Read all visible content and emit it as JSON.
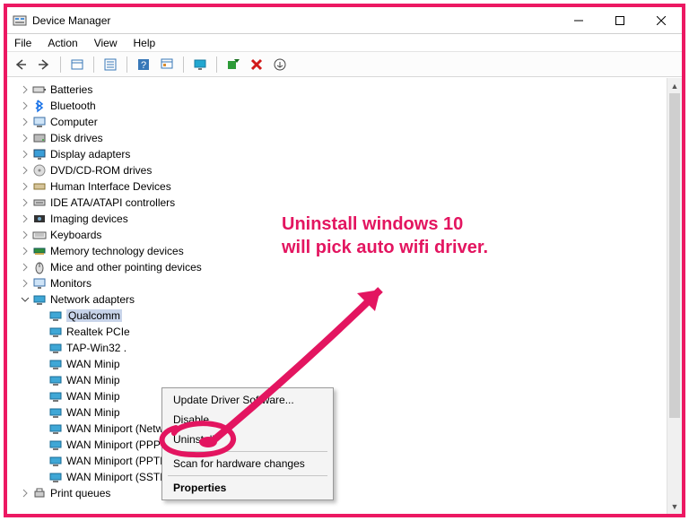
{
  "window": {
    "title": "Device Manager",
    "controls": {
      "min": "—",
      "max": "☐",
      "close": "✕"
    }
  },
  "menus": [
    "File",
    "Action",
    "View",
    "Help"
  ],
  "toolbar_icons": [
    "back",
    "forward",
    "show-hidden",
    "properties",
    "help",
    "update",
    "monitor",
    "scan",
    "delete",
    "more"
  ],
  "annotation": {
    "line1": "Uninstall windows 10",
    "line2": "will pick auto wifi driver."
  },
  "context_menu": {
    "items": [
      {
        "label": "Update Driver Software...",
        "bold": false
      },
      {
        "label": "Disable",
        "bold": false
      },
      {
        "label": "Uninstall",
        "bold": false
      },
      {
        "label": "Scan for hardware changes",
        "bold": false
      },
      {
        "label": "Properties",
        "bold": true
      }
    ]
  },
  "tree": {
    "categories": [
      {
        "label": "Batteries",
        "icon": "battery"
      },
      {
        "label": "Bluetooth",
        "icon": "bluetooth"
      },
      {
        "label": "Computer",
        "icon": "computer"
      },
      {
        "label": "Disk drives",
        "icon": "disk"
      },
      {
        "label": "Display adapters",
        "icon": "display"
      },
      {
        "label": "DVD/CD-ROM drives",
        "icon": "dvd"
      },
      {
        "label": "Human Interface Devices",
        "icon": "hid"
      },
      {
        "label": "IDE ATA/ATAPI controllers",
        "icon": "ide"
      },
      {
        "label": "Imaging devices",
        "icon": "imaging"
      },
      {
        "label": "Keyboards",
        "icon": "keyboard"
      },
      {
        "label": "Memory technology devices",
        "icon": "memory"
      },
      {
        "label": "Mice and other pointing devices",
        "icon": "mouse"
      },
      {
        "label": "Monitors",
        "icon": "monitor"
      },
      {
        "label": "Network adapters",
        "icon": "network",
        "expanded": true,
        "children": [
          {
            "label": "Qualcomm",
            "selected": true
          },
          {
            "label": "Realtek PCIe"
          },
          {
            "label": "TAP-Win32 ."
          },
          {
            "label": "WAN Minip"
          },
          {
            "label": "WAN Minip"
          },
          {
            "label": "WAN Minip"
          },
          {
            "label": "WAN Minip"
          },
          {
            "label": "WAN Miniport (Network Monitor)"
          },
          {
            "label": "WAN Miniport (PPPOE)"
          },
          {
            "label": "WAN Miniport (PPTP)"
          },
          {
            "label": "WAN Miniport (SSTP)"
          }
        ]
      },
      {
        "label": "Print queues",
        "icon": "print"
      }
    ]
  }
}
